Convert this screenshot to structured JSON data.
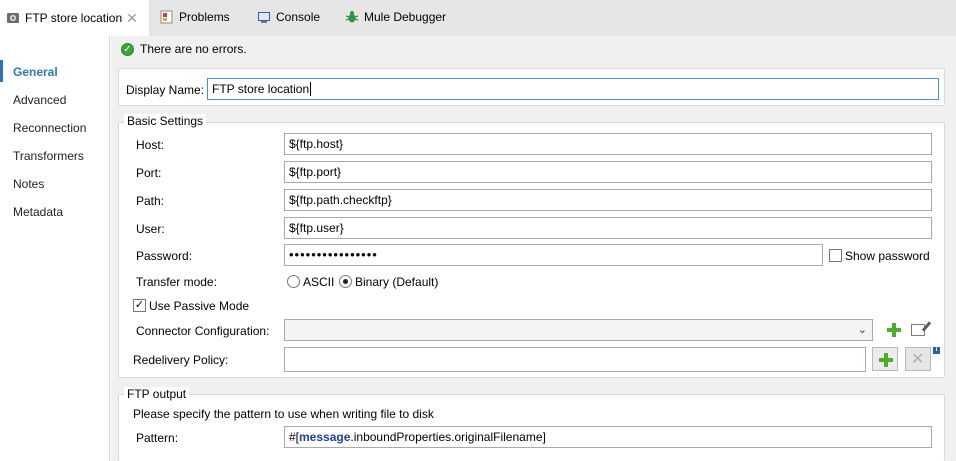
{
  "tabs": [
    {
      "label": "FTP store location",
      "icon": "ftp-endpoint-icon",
      "active": true,
      "close": "✕"
    },
    {
      "label": "Problems",
      "icon": "problems-icon"
    },
    {
      "label": "Console",
      "icon": "console-icon"
    },
    {
      "label": "Mule Debugger",
      "icon": "debug-bug-icon"
    }
  ],
  "nav": {
    "items": [
      "General",
      "Advanced",
      "Reconnection",
      "Transformers",
      "Notes",
      "Metadata"
    ],
    "active": "General"
  },
  "status": {
    "text": "There are no errors.",
    "icon": "check-ok-icon"
  },
  "display_name": {
    "label": "Display Name:",
    "value": "FTP store location"
  },
  "basic_settings": {
    "title": "Basic Settings",
    "host": {
      "label": "Host:",
      "value": "${ftp.host}"
    },
    "port": {
      "label": "Port:",
      "value": "${ftp.port}"
    },
    "path": {
      "label": "Path:",
      "value": "${ftp.path.checkftp}"
    },
    "user": {
      "label": "User:",
      "value": "${ftp.user}"
    },
    "password": {
      "label": "Password:",
      "value": "••••••••••••••••",
      "show_label": "Show password",
      "show_checked": false
    },
    "transfer_mode": {
      "label": "Transfer mode:",
      "options": [
        "ASCII",
        "Binary (Default)"
      ],
      "selected": "Binary (Default)"
    },
    "passive": {
      "label": "Use Passive Mode",
      "checked": true,
      "check_mark": "✓"
    },
    "connector": {
      "label": "Connector Configuration:",
      "value": "",
      "arrow": "⌄"
    },
    "redelivery": {
      "label": "Redelivery Policy:",
      "value": "",
      "remove_mark": "✕",
      "info_mark": "i"
    }
  },
  "ftp_output": {
    "title": "FTP output",
    "description": "Please specify the pattern to use when writing file to disk",
    "pattern": {
      "label": "Pattern:",
      "prefix": "#[",
      "keyword": "message",
      "suffix": ".inboundProperties.originalFilename]"
    }
  },
  "colors": {
    "accent": "#2f75b5",
    "add_green": "#4caf2a",
    "ok_green": "#3da53d"
  }
}
